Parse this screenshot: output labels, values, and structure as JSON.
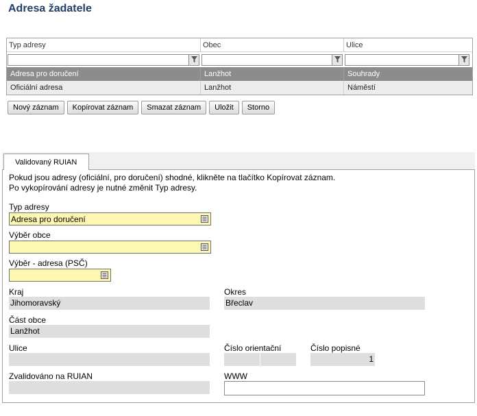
{
  "page": {
    "title": "Adresa žadatele"
  },
  "grid": {
    "columns": [
      "Typ adresy",
      "Obec",
      "Ulice"
    ],
    "rows": [
      {
        "typ": "Adresa pro doručení",
        "obec": "Lanžhot",
        "ulice": "Souhrady",
        "selected": true
      },
      {
        "typ": "Oficiální adresa",
        "obec": "Lanžhot",
        "ulice": "Náměstí",
        "selected": false
      }
    ]
  },
  "toolbar": {
    "new_label": "Nový záznam",
    "copy_label": "Kopírovat záznam",
    "delete_label": "Smazat záznam",
    "save_label": "Uložit",
    "cancel_label": "Storno"
  },
  "tab": {
    "label": "Validovaný RUIAN"
  },
  "form": {
    "note_line1": "Pokud jsou adresy (oficiální, pro doručení) shodné, klikněte na tlačítko Kopírovat záznam.",
    "note_line2": "Po vykopírování adresy je nutné změnit Typ adresy.",
    "typ_adresy_label": "Typ adresy",
    "typ_adresy_value": "Adresa pro doručení",
    "vyber_obce_label": "Výběr obce",
    "vyber_obce_value": "",
    "vyber_adresa_label": "Výběr - adresa (PSČ)",
    "vyber_adresa_value": "",
    "kraj_label": "Kraj",
    "kraj_value": "Jihomoravský",
    "okres_label": "Okres",
    "okres_value": "Břeclav",
    "cast_obce_label": "Část obce",
    "cast_obce_value": "Lanžhot",
    "ulice_label": "Ulice",
    "ulice_value": "",
    "cislo_orientacni_label": "Číslo orientační",
    "cislo_orientacni_value": "",
    "cislo_popisne_label": "Číslo popisné",
    "cislo_popisne_value": "1",
    "zvalidovano_label": "Zvalidováno na RUIAN",
    "zvalidovano_value": "",
    "www_label": "WWW",
    "www_value": ""
  },
  "icons": {
    "filter": "filter-icon",
    "lookup": "list-lookup-icon"
  },
  "colors": {
    "title": "#1f3d6e",
    "selected_row": "#8c8c8c",
    "required_field": "#fff8b0",
    "readonly_field": "#dedede"
  }
}
